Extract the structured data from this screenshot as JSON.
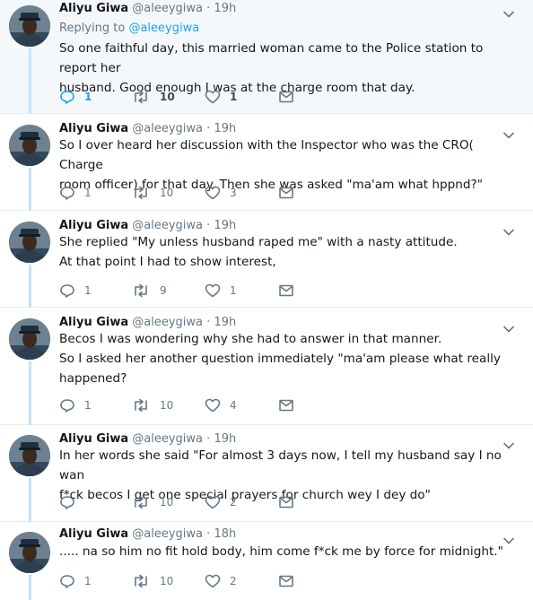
{
  "tweets": [
    {
      "name": "Aliyu Giwa",
      "handle": "@aleeygiwa",
      "dot": "·",
      "time": "19h",
      "replying_prefix": "Replying to ",
      "replying_to": "@aleeygiwa",
      "lines": [
        "So one faithful day, this married woman came to the Police station to report her",
        "husband. Good enough I was at the charge room that day."
      ],
      "replies": "1",
      "retweets": "10",
      "likes": "1"
    },
    {
      "name": "Aliyu Giwa",
      "handle": "@aleeygiwa",
      "dot": "·",
      "time": "19h",
      "lines": [
        "So I over heard her discussion with the Inspector who was the CRO( Charge",
        "room officer) for that day. Then she was asked \"ma'am what hppnd?\""
      ],
      "replies": "1",
      "retweets": "10",
      "likes": "3"
    },
    {
      "name": "Aliyu Giwa",
      "handle": "@aleeygiwa",
      "dot": "·",
      "time": "19h",
      "lines": [
        "She replied \"My unless husband raped me\" with a nasty attitude.",
        "At that point I had to show interest,"
      ],
      "replies": "1",
      "retweets": "9",
      "likes": "1"
    },
    {
      "name": "Aliyu Giwa",
      "handle": "@aleeygiwa",
      "dot": "·",
      "time": "19h",
      "lines": [
        "Becos I was wondering why she had to answer in that manner.",
        "So I asked her another question immediately \"ma'am please what really",
        "happened?"
      ],
      "replies": "1",
      "retweets": "10",
      "likes": "4"
    },
    {
      "name": "Aliyu Giwa",
      "handle": "@aleeygiwa",
      "dot": "·",
      "time": "19h",
      "lines": [
        "In her words she said \"For almost 3 days now, I tell my husband say I no wan",
        "f*ck becos I get one special prayers for church wey I dey do\""
      ],
      "replies": "",
      "retweets": "10",
      "likes": "2"
    },
    {
      "name": "Aliyu Giwa",
      "handle": "@aleeygiwa",
      "dot": "·",
      "time": "18h",
      "lines": [
        "..... na so him no fit hold body, him come f*ck me by force for midnight.\""
      ],
      "replies": "1",
      "retweets": "10",
      "likes": "2"
    }
  ],
  "icons": {
    "reply": "reply-icon",
    "retweet": "retweet-icon",
    "like": "heart-icon",
    "message": "envelope-icon",
    "more": "chevron-down-icon"
  },
  "colors": {
    "accent": "#1da1f2",
    "muted": "#657786",
    "thread_line": "#c4e3f7",
    "highlight_bg": "#f5f8fa"
  }
}
